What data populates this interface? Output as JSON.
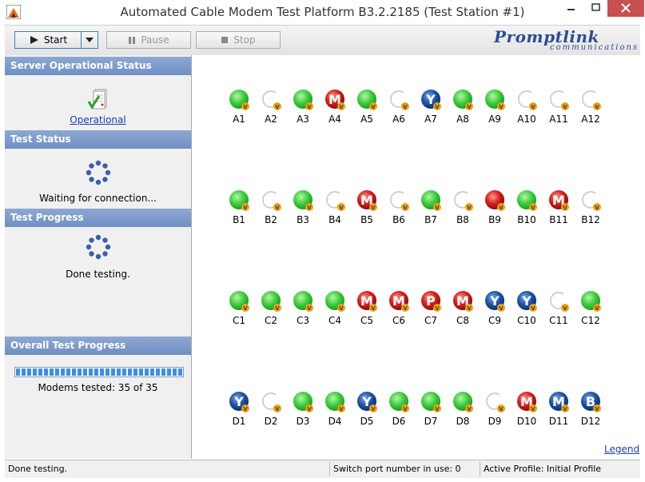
{
  "window": {
    "title": "Automated Cable Modem Test Platform B3.2.2185 (Test Station #1)"
  },
  "toolbar": {
    "start_label": "Start",
    "pause_label": "Pause",
    "stop_label": "Stop"
  },
  "logo": {
    "main": "Promptlink",
    "sub": "communications"
  },
  "left": {
    "server_status_header": "Server Operational Status",
    "server_status_link": "Operational",
    "test_status_header": "Test Status",
    "test_status_text": "Waiting for connection...",
    "test_progress_header": "Test Progress",
    "test_progress_text": "Done testing.",
    "overall_header": "Overall Test Progress",
    "overall_progress": 1.0,
    "modems_tested_text": "Modems tested: 35 of 35"
  },
  "main": {
    "legend_label": "Legend",
    "rows": [
      {
        "name": "A",
        "slots": [
          {
            "label": "A1",
            "state": "green"
          },
          {
            "label": "A2",
            "state": "empty"
          },
          {
            "label": "A3",
            "state": "green"
          },
          {
            "label": "A4",
            "state": "red",
            "letter": "M"
          },
          {
            "label": "A5",
            "state": "green"
          },
          {
            "label": "A6",
            "state": "empty"
          },
          {
            "label": "A7",
            "state": "blue",
            "letter": "Y"
          },
          {
            "label": "A8",
            "state": "green"
          },
          {
            "label": "A9",
            "state": "green"
          },
          {
            "label": "A10",
            "state": "empty"
          },
          {
            "label": "A11",
            "state": "empty"
          },
          {
            "label": "A12",
            "state": "empty"
          }
        ]
      },
      {
        "name": "B",
        "slots": [
          {
            "label": "B1",
            "state": "green"
          },
          {
            "label": "B2",
            "state": "empty"
          },
          {
            "label": "B3",
            "state": "green"
          },
          {
            "label": "B4",
            "state": "empty"
          },
          {
            "label": "B5",
            "state": "red",
            "letter": "M"
          },
          {
            "label": "B6",
            "state": "empty"
          },
          {
            "label": "B7",
            "state": "green"
          },
          {
            "label": "B8",
            "state": "empty"
          },
          {
            "label": "B9",
            "state": "red"
          },
          {
            "label": "B10",
            "state": "green"
          },
          {
            "label": "B11",
            "state": "red",
            "letter": "M"
          },
          {
            "label": "B12",
            "state": "empty"
          }
        ]
      },
      {
        "name": "C",
        "slots": [
          {
            "label": "C1",
            "state": "green"
          },
          {
            "label": "C2",
            "state": "green"
          },
          {
            "label": "C3",
            "state": "green"
          },
          {
            "label": "C4",
            "state": "green"
          },
          {
            "label": "C5",
            "state": "red",
            "letter": "M"
          },
          {
            "label": "C6",
            "state": "red",
            "letter": "M"
          },
          {
            "label": "C7",
            "state": "red",
            "letter": "P"
          },
          {
            "label": "C8",
            "state": "red",
            "letter": "M"
          },
          {
            "label": "C9",
            "state": "blue",
            "letter": "Y"
          },
          {
            "label": "C10",
            "state": "blue",
            "letter": "Y"
          },
          {
            "label": "C11",
            "state": "empty"
          },
          {
            "label": "C12",
            "state": "green"
          }
        ]
      },
      {
        "name": "D",
        "slots": [
          {
            "label": "D1",
            "state": "blue",
            "letter": "Y"
          },
          {
            "label": "D2",
            "state": "empty"
          },
          {
            "label": "D3",
            "state": "green"
          },
          {
            "label": "D4",
            "state": "green"
          },
          {
            "label": "D5",
            "state": "blue",
            "letter": "Y"
          },
          {
            "label": "D6",
            "state": "green"
          },
          {
            "label": "D7",
            "state": "green"
          },
          {
            "label": "D8",
            "state": "green"
          },
          {
            "label": "D9",
            "state": "empty"
          },
          {
            "label": "D10",
            "state": "red",
            "letter": "M"
          },
          {
            "label": "D11",
            "state": "blue",
            "letter": "M"
          },
          {
            "label": "D12",
            "state": "blue",
            "letter": "B"
          }
        ]
      }
    ],
    "badge_letter": "V"
  },
  "statusbar": {
    "message": "Done testing.",
    "switch_port": "Switch port number in use: 0",
    "active_profile": "Active Profile: Initial Profile"
  },
  "colors": {
    "green": "#3fcf3f",
    "red": "#d81e1e",
    "blue": "#1e55a8",
    "badge": "#e6a21a",
    "header": "#7b98c9"
  },
  "icons": {
    "app": "app-logo-icon",
    "start": "play-icon",
    "dropdown": "caret-down-icon",
    "pause": "pause-icon",
    "stop": "stop-icon",
    "operational": "checklist-icon",
    "spinner": "loading-spinner-icon"
  }
}
